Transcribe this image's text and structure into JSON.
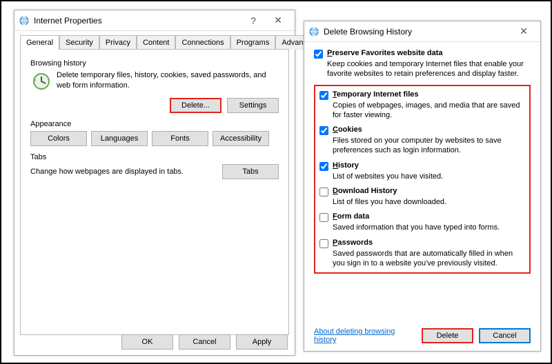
{
  "ip": {
    "title": "Internet Properties",
    "tabs": [
      "General",
      "Security",
      "Privacy",
      "Content",
      "Connections",
      "Programs",
      "Advanced"
    ],
    "section_bh": "Browsing history",
    "bh_text": "Delete temporary files, history, cookies, saved passwords, and web form information.",
    "delete_btn": "Delete...",
    "settings_btn": "Settings",
    "section_app": "Appearance",
    "app_btns": [
      "Colors",
      "Languages",
      "Fonts",
      "Accessibility"
    ],
    "section_tabs": "Tabs",
    "tabs_text": "Change how webpages are displayed in tabs.",
    "tabs_btn": "Tabs",
    "ok": "OK",
    "cancel": "Cancel",
    "apply": "Apply"
  },
  "dbh": {
    "title": "Delete Browsing History",
    "opt0": {
      "label": "Preserve Favorites website data",
      "desc": "Keep cookies and temporary Internet files that enable your favorite websites to retain preferences and display faster.",
      "checked": true
    },
    "opt1": {
      "label": "Temporary Internet files",
      "desc": "Copies of webpages, images, and media that are saved for faster viewing.",
      "checked": true
    },
    "opt2": {
      "label": "Cookies",
      "desc": "Files stored on your computer by websites to save preferences such as login information.",
      "checked": true
    },
    "opt3": {
      "label": "History",
      "desc": "List of websites you have visited.",
      "checked": true
    },
    "opt4": {
      "label": "Download History",
      "desc": "List of files you have downloaded.",
      "checked": false
    },
    "opt5": {
      "label": "Form data",
      "desc": "Saved information that you have typed into forms.",
      "checked": false
    },
    "opt6": {
      "label": "Passwords",
      "desc": "Saved passwords that are automatically filled in when you sign in to a website you've previously visited.",
      "checked": false
    },
    "about_link": "About deleting browsing history",
    "delete_btn": "Delete",
    "cancel_btn": "Cancel"
  }
}
